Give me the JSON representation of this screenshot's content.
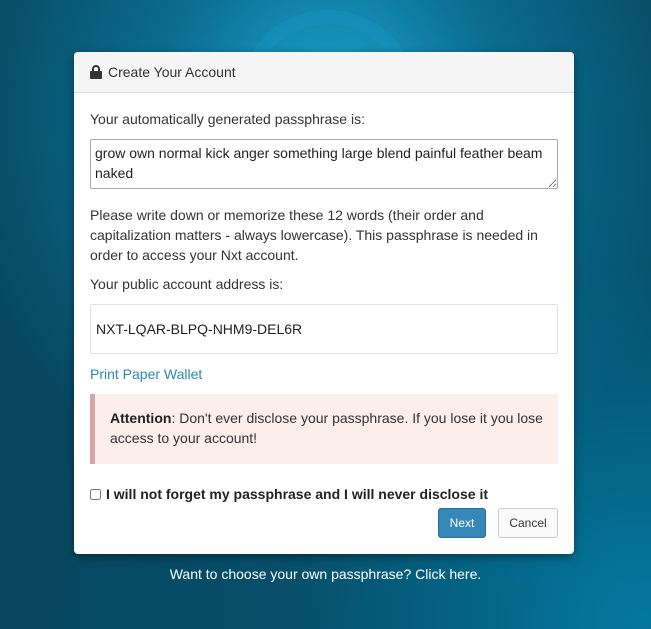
{
  "modal": {
    "title": "Create Your Account",
    "lock_icon": "lock-icon",
    "passphrase_label": "Your automatically generated passphrase is:",
    "passphrase_value": "grow own normal kick anger something large blend painful feather beam naked",
    "instruction": "Please write down or memorize these 12 words (their order and capitalization matters - always lowercase). This passphrase is needed in order to access your Nxt account.",
    "address_label": "Your public account address is:",
    "address_value": "NXT-LQAR-BLPQ-NHM9-DEL6R",
    "print_link": "Print Paper Wallet",
    "alert_strong": "Attention",
    "alert_text": ": Don't ever disclose your passphrase. If you lose it you lose access to your account!",
    "confirm_label": "I will not forget my passphrase and I will never disclose it",
    "next_label": "Next",
    "cancel_label": "Cancel"
  },
  "footer": {
    "choose_own_link": "Want to choose your own passphrase? Click here."
  },
  "colors": {
    "link": "#2a88b4",
    "primary_button": "#3487b6",
    "alert_bg": "#fbeeeb",
    "alert_border": "#d9a4a4"
  }
}
